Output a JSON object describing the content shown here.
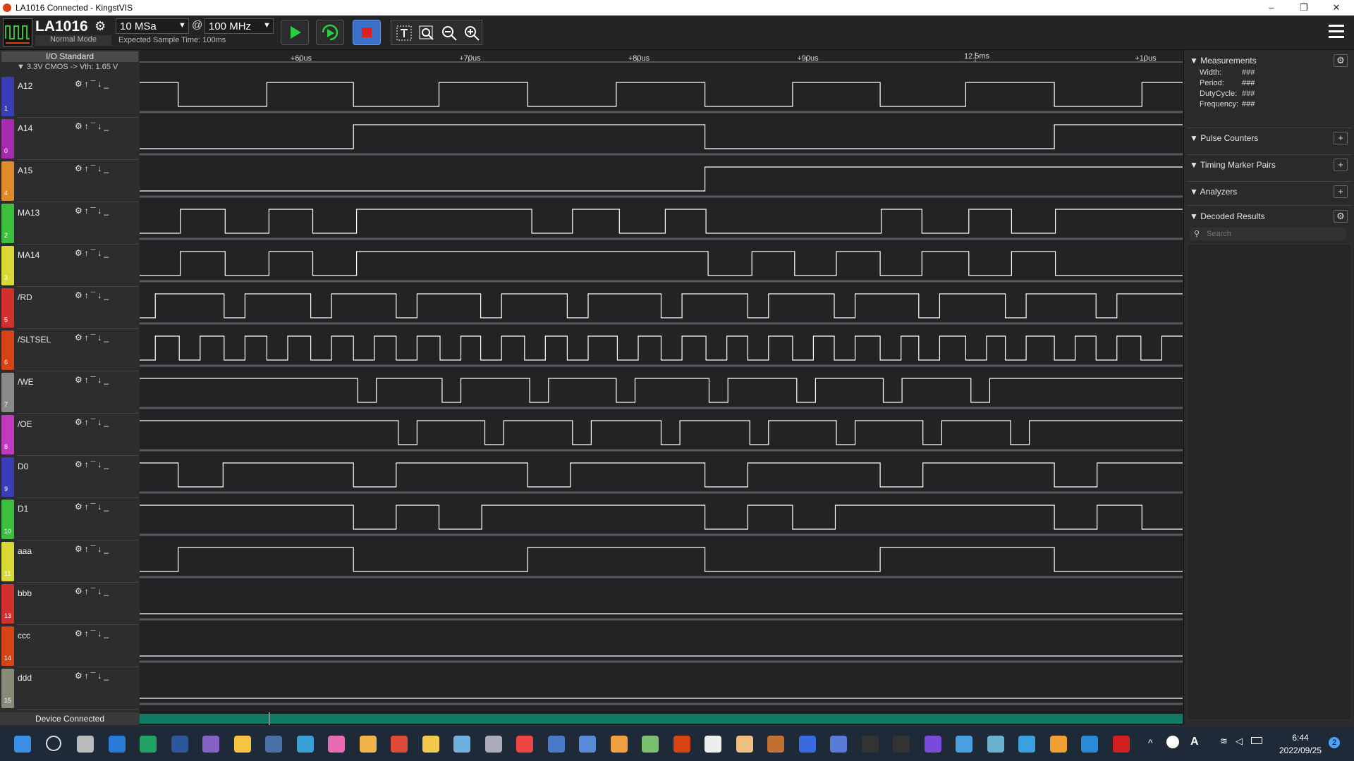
{
  "window": {
    "title": "LA1016 Connected - KingstVIS",
    "controls": [
      "–",
      "❒",
      "✕"
    ]
  },
  "toolbar": {
    "device": "LA1016",
    "mode": "Normal Mode",
    "depth": "10 MSa",
    "at": "@",
    "rate": "100 MHz",
    "expected": "Expected Sample Time: 100ms",
    "menu_icon": "hamburger-icon"
  },
  "io": {
    "header": "I/O Standard",
    "standard": "▼ 3.3V CMOS -> Vth: 1.65 V"
  },
  "timeline": {
    "marks": [
      {
        "label": "+60us",
        "major": false
      },
      {
        "label": "+70us",
        "major": false
      },
      {
        "label": "+80us",
        "major": false
      },
      {
        "label": "+90us",
        "major": false
      },
      {
        "label": "12.5ms",
        "major": true
      },
      {
        "label": "+10us",
        "major": false
      }
    ]
  },
  "channels": [
    {
      "name": "A12",
      "num": "1",
      "color": "#3a3db8",
      "edges": [
        0.037,
        0.122,
        0.205,
        0.287,
        0.372,
        0.457,
        0.542,
        0.626,
        0.71,
        0.792,
        0.877,
        0.961
      ],
      "start": 1
    },
    {
      "name": "A14",
      "num": "0",
      "color": "#a62bb0",
      "edges": [
        0.205,
        0.542,
        0.877
      ],
      "start": 0
    },
    {
      "name": "A15",
      "num": "4",
      "color": "#e08a2b",
      "edges": [
        0.542
      ],
      "start": 0
    },
    {
      "name": "MA13",
      "num": "2",
      "color": "#3cbf3c",
      "edges": [
        0.039,
        0.082,
        0.124,
        0.166,
        0.208,
        0.376,
        0.415,
        0.46,
        0.504,
        0.543,
        0.711,
        0.75,
        0.795,
        0.836,
        0.878
      ],
      "start": 0
    },
    {
      "name": "MA14",
      "num": "3",
      "color": "#d9d936",
      "edges": [
        0.039,
        0.082,
        0.124,
        0.166,
        0.208,
        0.545,
        0.587,
        0.628,
        0.668,
        0.71,
        0.75,
        0.795,
        0.836,
        0.878
      ],
      "start": 0
    },
    {
      "name": "/RD",
      "num": "5",
      "color": "#d32f2f",
      "edges": [
        0.015,
        0.081,
        0.101,
        0.164,
        0.184,
        0.246,
        0.266,
        0.327,
        0.347,
        0.41,
        0.43,
        0.5,
        0.52,
        0.583,
        0.603,
        0.666,
        0.686,
        0.747,
        0.767,
        0.83,
        0.85,
        0.917,
        0.937
      ],
      "start": 0
    },
    {
      "name": "/SLTSEL",
      "num": "6",
      "color": "#d84315",
      "edges": [
        0.015,
        0.038,
        0.058,
        0.081,
        0.101,
        0.122,
        0.142,
        0.164,
        0.184,
        0.205,
        0.225,
        0.246,
        0.266,
        0.288,
        0.308,
        0.327,
        0.347,
        0.369,
        0.389,
        0.41,
        0.43,
        0.458,
        0.478,
        0.5,
        0.52,
        0.543,
        0.563,
        0.583,
        0.603,
        0.626,
        0.646,
        0.666,
        0.686,
        0.71,
        0.73,
        0.747,
        0.767,
        0.792,
        0.812,
        0.83,
        0.85,
        0.877,
        0.897,
        0.917,
        0.937,
        0.96,
        0.98
      ],
      "start": 0
    },
    {
      "name": "/WE",
      "num": "7",
      "color": "#8a8a8a",
      "edges": [
        0.209,
        0.227,
        0.29,
        0.308,
        0.374,
        0.392,
        0.457,
        0.475,
        0.546,
        0.564,
        0.63,
        0.648,
        0.713,
        0.731,
        0.797,
        0.815
      ],
      "start": 1
    },
    {
      "name": "/OE",
      "num": "8",
      "color": "#c03ac0",
      "edges": [
        0.248,
        0.266,
        0.331,
        0.349,
        0.415,
        0.433,
        0.5,
        0.518,
        0.585,
        0.603,
        0.668,
        0.686,
        0.751,
        0.769,
        0.835,
        0.853
      ],
      "start": 1
    },
    {
      "name": "D0",
      "num": "9",
      "color": "#3a3db8",
      "edges": [
        0.037,
        0.08,
        0.205,
        0.246,
        0.372,
        0.413,
        0.542,
        0.583,
        0.71,
        0.751,
        0.877,
        0.918
      ],
      "start": 1
    },
    {
      "name": "D1",
      "num": "10",
      "color": "#3cbf3c",
      "edges": [
        0.205,
        0.246,
        0.287,
        0.328,
        0.542,
        0.583,
        0.626,
        0.667,
        0.877,
        0.918,
        0.961
      ],
      "start": 1
    },
    {
      "name": "aaa",
      "num": "11",
      "color": "#d9d936",
      "edges": [
        0.037,
        0.205,
        0.372,
        0.542,
        0.71,
        0.877
      ],
      "start": 0
    },
    {
      "name": "bbb",
      "num": "13",
      "color": "#d32f2f",
      "edges": [],
      "start": 0
    },
    {
      "name": "ccc",
      "num": "14",
      "color": "#d84315",
      "edges": [],
      "start": 0
    },
    {
      "name": "ddd",
      "num": "15",
      "color": "#8a8a7a",
      "edges": [],
      "start": 0
    }
  ],
  "measurements": {
    "title": "Measurements",
    "rows": [
      {
        "label": "Width:",
        "value": "###"
      },
      {
        "label": "Period:",
        "value": "###"
      },
      {
        "label": "DutyCycle:",
        "value": "###"
      },
      {
        "label": "Frequency:",
        "value": "###"
      }
    ]
  },
  "panels": {
    "pulse_counters": "Pulse Counters",
    "timing_markers": "Timing Marker Pairs",
    "analyzers": "Analyzers",
    "decoded": "Decoded Results",
    "search_placeholder": "Search"
  },
  "status": {
    "left": "Device Connected"
  },
  "taskbar": {
    "time": "6:44",
    "date": "2022/09/25",
    "badge": "2",
    "apps": [
      "windows-start-icon",
      "search-icon",
      "task-view-icon",
      "mail-icon",
      "excel-icon",
      "word-icon",
      "visual-studio-icon",
      "file-explorer-icon",
      "calculator-icon",
      "globe-icon",
      "paint-icon",
      "folder-icon",
      "chrome-icon",
      "app-icon",
      "image-icon",
      "scanner-icon",
      "app-icon",
      "msx-icon",
      "pen-icon",
      "media-icon",
      "tool-icon",
      "kingstvis-icon",
      "record-icon",
      "figure-icon",
      "arrow-icon",
      "figure-icon",
      "app-icon",
      "terminal-icon",
      "terminal-icon",
      "github-icon",
      "app-icon",
      "network-icon",
      "app-icon",
      "chart-icon",
      "vscode-icon",
      "pdf-icon"
    ]
  }
}
